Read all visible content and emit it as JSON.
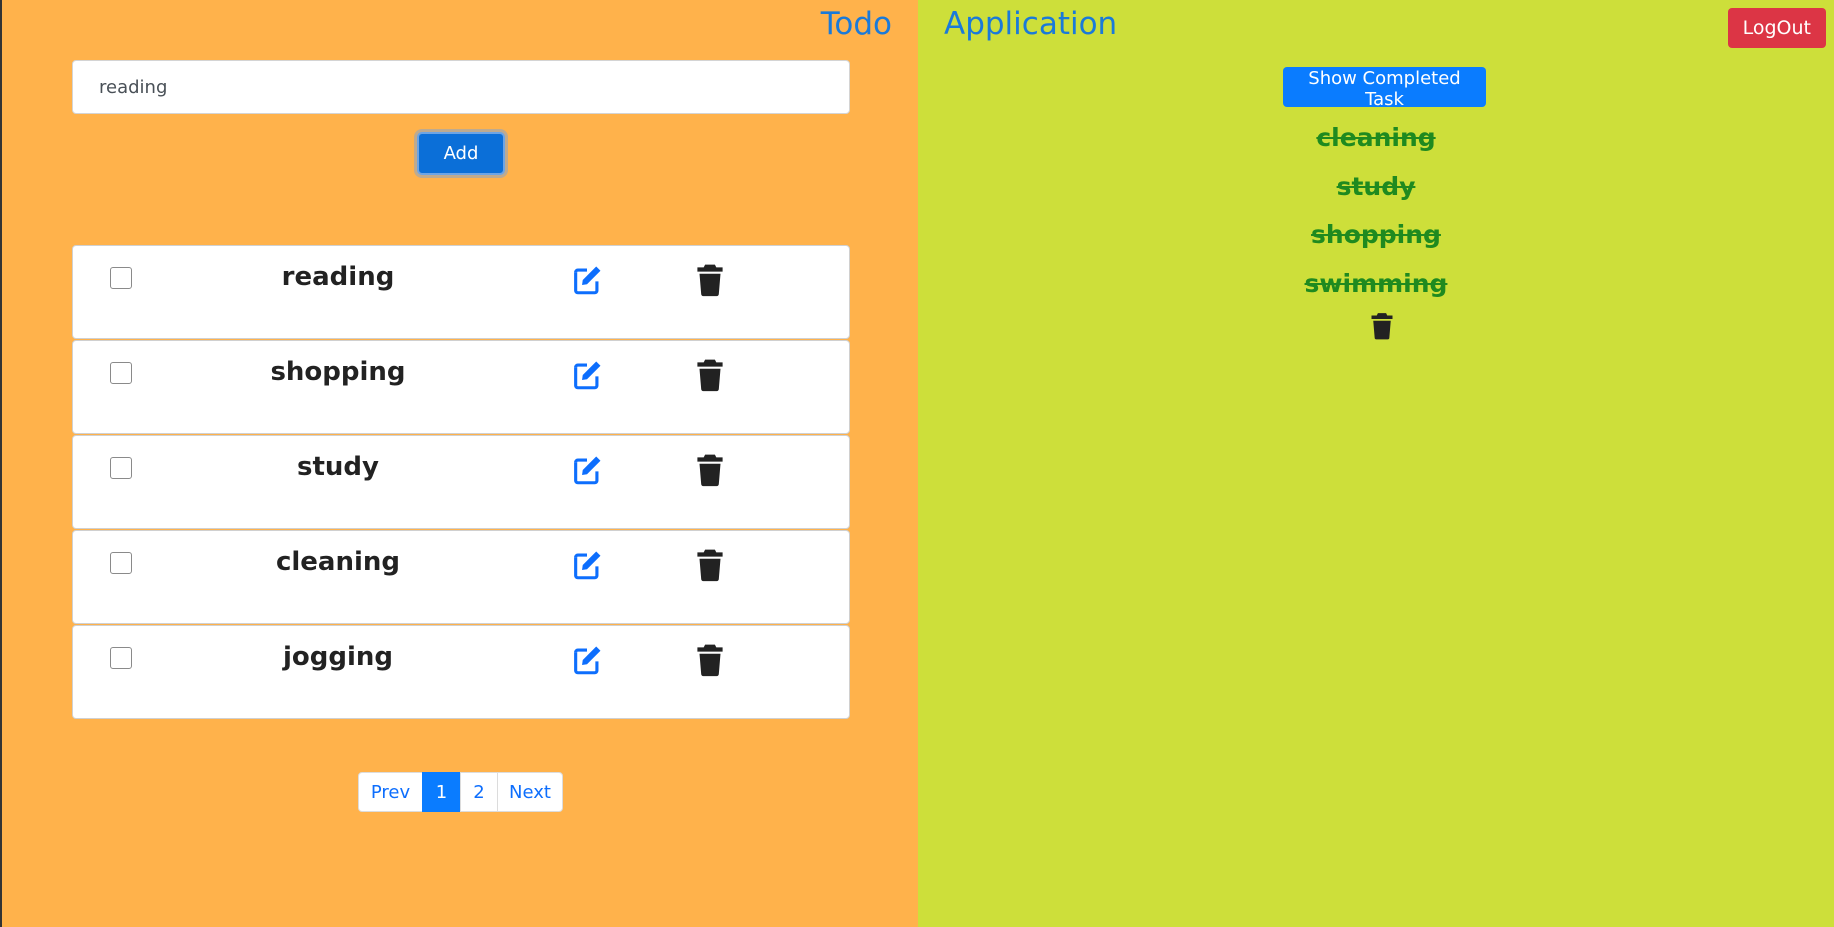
{
  "header": {
    "title_left": "Todo",
    "title_right": "Application",
    "logout_label": "LogOut"
  },
  "todo": {
    "input_value": "reading",
    "add_label": "Add",
    "tasks": [
      {
        "label": "reading",
        "checked": false
      },
      {
        "label": "shopping",
        "checked": false
      },
      {
        "label": "study",
        "checked": false
      },
      {
        "label": "cleaning",
        "checked": false
      },
      {
        "label": "jogging",
        "checked": false
      }
    ],
    "pagination": {
      "prev": "Prev",
      "pages": [
        "1",
        "2"
      ],
      "current": "1",
      "next": "Next"
    }
  },
  "completed": {
    "show_label": "Show Completed Task",
    "items": [
      "cleaning",
      "study",
      "shopping",
      "swimming"
    ]
  },
  "icons": {
    "edit": "edit-icon",
    "delete": "trash-icon"
  },
  "colors": {
    "left_bg": "#ffb24b",
    "right_bg": "#cddf3a",
    "primary": "#0a7cff",
    "danger": "#dc3545",
    "completed_text": "#1f8a1f"
  }
}
